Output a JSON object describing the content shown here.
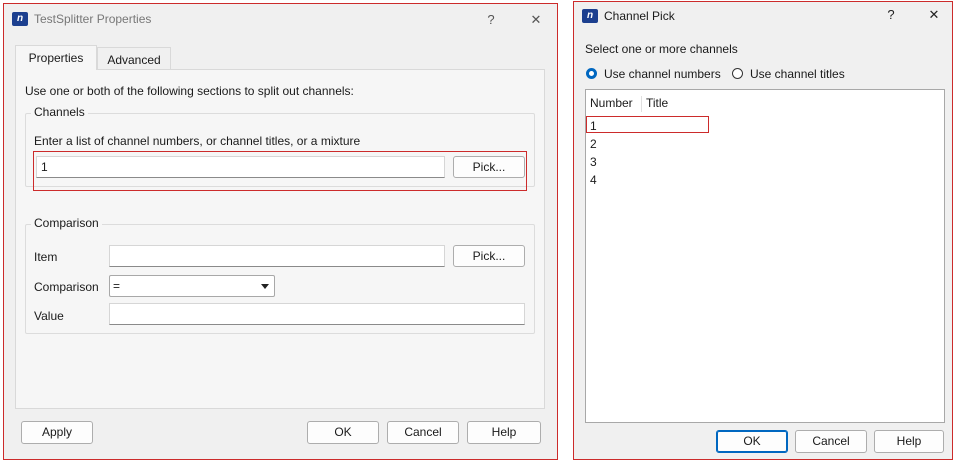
{
  "props": {
    "title": "TestSplitter Properties",
    "help_glyph": "?",
    "close_glyph": "✕",
    "tabs": [
      {
        "label": "Properties",
        "active": true
      },
      {
        "label": "Advanced",
        "active": false
      }
    ],
    "intro": "Use one or both of the following sections to split out channels:",
    "channels": {
      "group_title": "Channels",
      "hint": "Enter a list of channel numbers, or channel titles, or a mixture",
      "value": "1",
      "pick_label": "Pick..."
    },
    "comparison": {
      "group_title": "Comparison",
      "item_label": "Item",
      "item_value": "",
      "pick_label": "Pick...",
      "comparison_label": "Comparison",
      "comparison_value": "=",
      "value_label": "Value",
      "value_value": ""
    },
    "buttons": {
      "apply": "Apply",
      "ok": "OK",
      "cancel": "Cancel",
      "help": "Help"
    }
  },
  "pick": {
    "title": "Channel Pick",
    "help_glyph": "?",
    "close_glyph": "✕",
    "instruction": "Select one or more channels",
    "radio_numbers": "Use channel numbers",
    "radio_titles": "Use channel titles",
    "selected_mode": "numbers",
    "columns": [
      "Number",
      "Title"
    ],
    "rows": [
      {
        "number": "1",
        "title": ""
      },
      {
        "number": "2",
        "title": ""
      },
      {
        "number": "3",
        "title": ""
      },
      {
        "number": "4",
        "title": ""
      }
    ],
    "buttons": {
      "ok": "OK",
      "cancel": "Cancel",
      "help": "Help"
    }
  },
  "colors": {
    "accent": "#0067c0",
    "highlight": "#cc2b2b",
    "icon": "#1c3f8f"
  }
}
